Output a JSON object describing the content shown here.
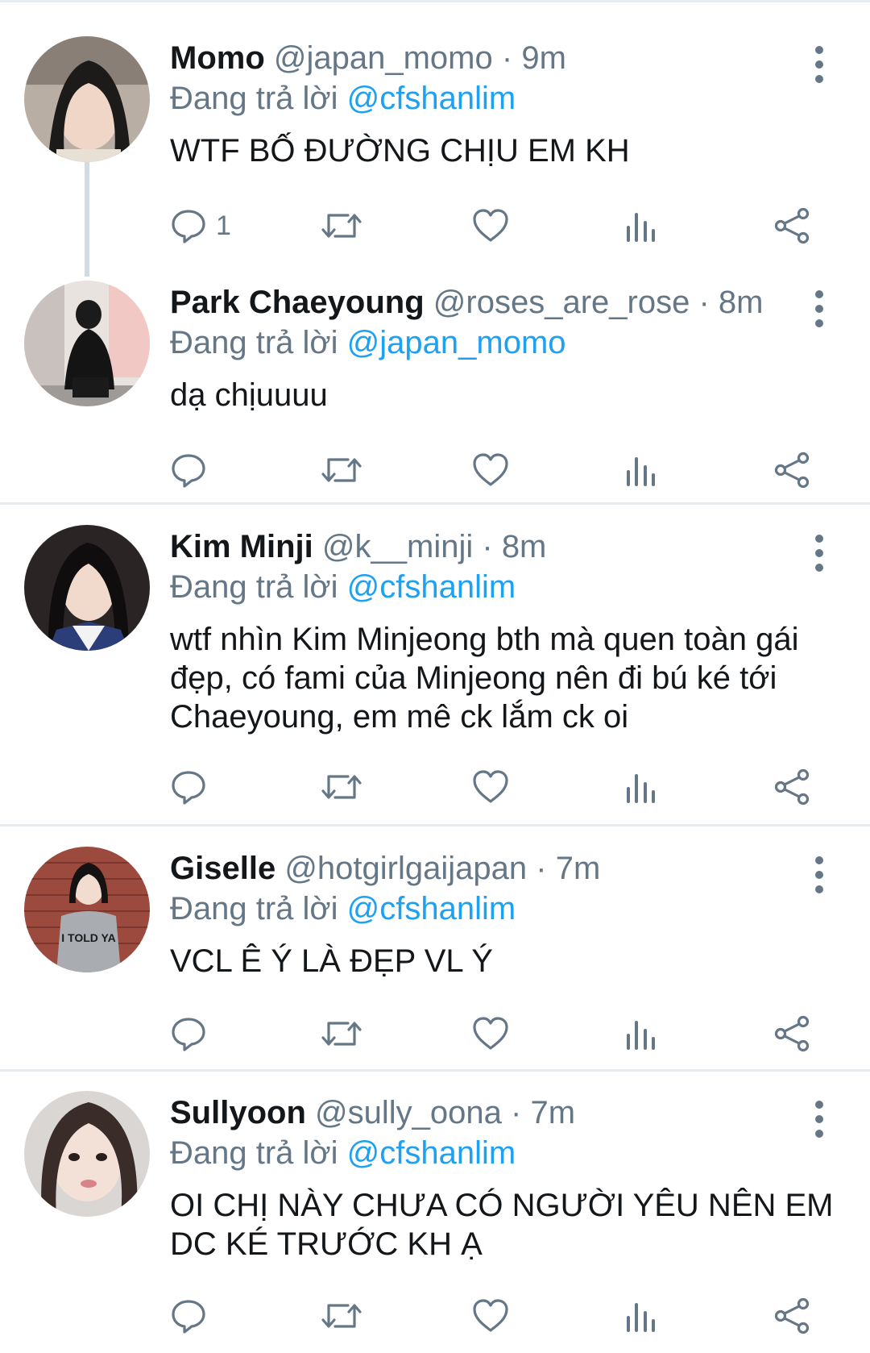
{
  "reply_prefix": "Đang trả lời",
  "tweets": [
    {
      "name": "Momo",
      "handle": "@japan_momo",
      "dot": "·",
      "time": "9m",
      "reply_to": "@cfshanlim",
      "text": "WTF BỐ ĐƯỜNG CHỊU EM KH",
      "reply_count": "1"
    },
    {
      "name": "Park Chaeyoung",
      "handle": "@roses_are_rose",
      "dot": "·",
      "time": "8m",
      "reply_to": "@japan_momo",
      "text": "dạ chịuuuu",
      "reply_count": ""
    },
    {
      "name": "Kim Minji",
      "handle": "@k__minji",
      "dot": "·",
      "time": "8m",
      "reply_to": "@cfshanlim",
      "text": "wtf nhìn Kim Minjeong bth mà quen toàn gái đẹp, có fami của Minjeong nên đi bú ké tới Chaeyoung, em mê ck lắm ck oi",
      "reply_count": ""
    },
    {
      "name": "Giselle",
      "handle": "@hotgirlgaijapan",
      "dot": "·",
      "time": "7m",
      "reply_to": "@cfshanlim",
      "text": "VCL Ê Ý LÀ ĐẸP VL Ý",
      "reply_count": ""
    },
    {
      "name": "Sullyoon",
      "handle": "@sully_oona",
      "dot": "·",
      "time": "7m",
      "reply_to": "@cfshanlim",
      "text": "OI CHỊ NÀY CHƯA CÓ NGƯỜI YÊU NÊN EM DC KÉ TRƯỚC KH Ạ",
      "reply_count": ""
    }
  ],
  "avatar_shirt_text": "I TOLD YA",
  "colors": {
    "accent": "#1da1f2",
    "muted": "#657786",
    "separator": "#e6ecf0",
    "thread_line": "#d3dbe1"
  },
  "icons": [
    "reply-icon",
    "retweet-icon",
    "like-icon",
    "analytics-icon",
    "share-icon",
    "more-options-icon"
  ]
}
